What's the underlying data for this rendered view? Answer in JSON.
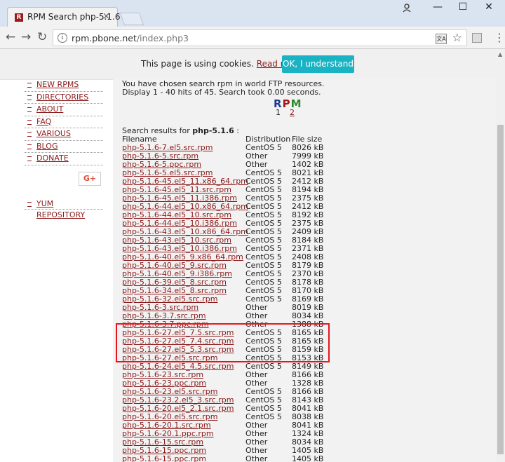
{
  "browser": {
    "tab_title": "RPM Search php-5.1.6",
    "tab_favicon": "R",
    "tab_close": "×",
    "url_domain": "rpm.pbone.net",
    "url_path": "/index.php3",
    "back_icon": "←",
    "forward_icon": "→",
    "reload_icon": "↻",
    "star_icon": "☆",
    "translate_icon": "文A",
    "menu_icon": "⋮",
    "minimize_icon": "—",
    "maximize_icon": "☐",
    "close_icon": "✕"
  },
  "cookie": {
    "text": "This page is using cookies.",
    "link": "Read more",
    "button": "OK, I understand"
  },
  "sidebar": {
    "items": [
      {
        "label": "NEW RPMS"
      },
      {
        "label": "DIRECTORIES"
      },
      {
        "label": "ABOUT"
      },
      {
        "label": "FAQ"
      },
      {
        "label": "VARIOUS"
      },
      {
        "label": "BLOG"
      },
      {
        "label": "DONATE"
      }
    ],
    "gplus": "G+",
    "yum": "YUM REPOSITORY"
  },
  "main": {
    "info1": "You have chosen search rpm in world FTP resources.",
    "info2": "Display 1 - 40 hits of 45. Search took 0.00 seconds.",
    "logo_r": "R",
    "logo_p": "P",
    "logo_m": "M",
    "page1": "1",
    "page2": "2",
    "results_prefix": "Search results for",
    "results_query": "php-5.1.6",
    "results_suffix": " :",
    "col_filename": "Filename",
    "col_distribution": "Distribution",
    "col_filesize": "File size"
  },
  "rows": [
    [
      "php-5.1.6-7.el5.src.rpm",
      "CentOS 5",
      "8026 kB"
    ],
    [
      "php-5.1.6-5.src.rpm",
      "Other",
      "7999 kB"
    ],
    [
      "php-5.1.6-5.ppc.rpm",
      "Other",
      "1402 kB"
    ],
    [
      "php-5.1.6-5.el5.src.rpm",
      "CentOS 5",
      "8021 kB"
    ],
    [
      "php-5.1.6-45.el5_11.x86_64.rpm",
      "CentOS 5",
      "2412 kB"
    ],
    [
      "php-5.1.6-45.el5_11.src.rpm",
      "CentOS 5",
      "8194 kB"
    ],
    [
      "php-5.1.6-45.el5_11.i386.rpm",
      "CentOS 5",
      "2375 kB"
    ],
    [
      "php-5.1.6-44.el5_10.x86_64.rpm",
      "CentOS 5",
      "2412 kB"
    ],
    [
      "php-5.1.6-44.el5_10.src.rpm",
      "CentOS 5",
      "8192 kB"
    ],
    [
      "php-5.1.6-44.el5_10.i386.rpm",
      "CentOS 5",
      "2375 kB"
    ],
    [
      "php-5.1.6-43.el5_10.x86_64.rpm",
      "CentOS 5",
      "2409 kB"
    ],
    [
      "php-5.1.6-43.el5_10.src.rpm",
      "CentOS 5",
      "8184 kB"
    ],
    [
      "php-5.1.6-43.el5_10.i386.rpm",
      "CentOS 5",
      "2371 kB"
    ],
    [
      "php-5.1.6-40.el5_9.x86_64.rpm",
      "CentOS 5",
      "2408 kB"
    ],
    [
      "php-5.1.6-40.el5_9.src.rpm",
      "CentOS 5",
      "8179 kB"
    ],
    [
      "php-5.1.6-40.el5_9.i386.rpm",
      "CentOS 5",
      "2370 kB"
    ],
    [
      "php-5.1.6-39.el5_8.src.rpm",
      "CentOS 5",
      "8178 kB"
    ],
    [
      "php-5.1.6-34.el5_8.src.rpm",
      "CentOS 5",
      "8170 kB"
    ],
    [
      "php-5.1.6-32.el5.src.rpm",
      "CentOS 5",
      "8169 kB"
    ],
    [
      "php-5.1.6-3.src.rpm",
      "Other",
      "8019 kB"
    ],
    [
      "php-5.1.6-3.7.src.rpm",
      "Other",
      "8034 kB"
    ],
    [
      "php-5.1.6-3.7.ppc.rpm",
      "Other",
      "1388 kB"
    ],
    [
      "php-5.1.6-27.el5_7.5.src.rpm",
      "CentOS 5",
      "8165 kB"
    ],
    [
      "php-5.1.6-27.el5_7.4.src.rpm",
      "CentOS 5",
      "8165 kB"
    ],
    [
      "php-5.1.6-27.el5_5.3.src.rpm",
      "CentOS 5",
      "8159 kB"
    ],
    [
      "php-5.1.6-27.el5.src.rpm",
      "CentOS 5",
      "8153 kB"
    ],
    [
      "php-5.1.6-24.el5_4.5.src.rpm",
      "CentOS 5",
      "8149 kB"
    ],
    [
      "php-5.1.6-23.src.rpm",
      "Other",
      "8166 kB"
    ],
    [
      "php-5.1.6-23.ppc.rpm",
      "Other",
      "1328 kB"
    ],
    [
      "php-5.1.6-23.el5.src.rpm",
      "CentOS 5",
      "8166 kB"
    ],
    [
      "php-5.1.6-23.2.el5_3.src.rpm",
      "CentOS 5",
      "8143 kB"
    ],
    [
      "php-5.1.6-20.el5_2.1.src.rpm",
      "CentOS 5",
      "8041 kB"
    ],
    [
      "php-5.1.6-20.el5.src.rpm",
      "CentOS 5",
      "8038 kB"
    ],
    [
      "php-5.1.6-20.1.src.rpm",
      "Other",
      "8041 kB"
    ],
    [
      "php-5.1.6-20.1.ppc.rpm",
      "Other",
      "1324 kB"
    ],
    [
      "php-5.1.6-15.src.rpm",
      "Other",
      "8034 kB"
    ],
    [
      "php-5.1.6-15.ppc.rpm",
      "Other",
      "1405 kB"
    ],
    [
      "php-5.1.6-15.ppc.rpm",
      "Other",
      "1405 kB"
    ]
  ]
}
